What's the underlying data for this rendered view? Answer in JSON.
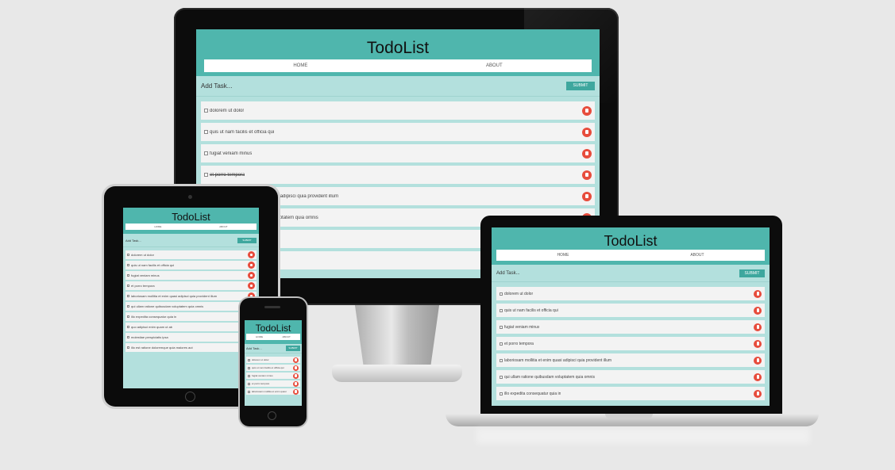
{
  "app": {
    "title": "TodoList",
    "nav": [
      "Home",
      "About"
    ],
    "add_placeholder": "Add Task...",
    "submit_label": "Submit"
  },
  "colors": {
    "header": "#4fb6ad",
    "body": "#b3e0dd",
    "task_bg": "#f3f3f3",
    "delete": "#e74c3c",
    "button": "#3ea79e",
    "background": "#e8e8e8"
  },
  "desktop": {
    "tasks": [
      {
        "text": "dolorem ut dolor",
        "done": false
      },
      {
        "text": "quis ut nam facilis et officia qui",
        "done": false
      },
      {
        "text": "fugiat veniam minus",
        "done": false
      },
      {
        "text": "et porro tempora",
        "done": true
      },
      {
        "text": "laboriosam mollitia et enim quasi adipisci quia provident illum",
        "done": false
      },
      {
        "text": "qui ullam ratione quibusdam voluptatem quia omnis",
        "done": false
      },
      {
        "text": "",
        "done": false
      },
      {
        "text": "",
        "done": false
      }
    ]
  },
  "laptop": {
    "tasks": [
      {
        "text": "dolorem ut dolor",
        "done": false
      },
      {
        "text": "quis ut nam facilis et officia qui",
        "done": false
      },
      {
        "text": "fugiat veniam minus",
        "done": false
      },
      {
        "text": "et porro tempora",
        "done": false
      },
      {
        "text": "laboriosam mollitia et enim quasi adipisci quia provident illum",
        "done": false
      },
      {
        "text": "qui ullam ratione quibusdam voluptatem quia omnis",
        "done": false
      },
      {
        "text": "illo expedita consequatur quia in",
        "done": false
      }
    ]
  },
  "tablet": {
    "tasks": [
      {
        "text": "dolorem ut dolor",
        "done": false
      },
      {
        "text": "quis ut nam facilis et officia qui",
        "done": false
      },
      {
        "text": "fugiat veniam minus",
        "done": false
      },
      {
        "text": "et porro tempora",
        "done": false
      },
      {
        "text": "laboriosam mollitia et enim quasi adipisci quia provident illum",
        "done": false
      },
      {
        "text": "qui ullam ratione quibusdam voluptatem quia omnis",
        "done": false
      },
      {
        "text": "illo expedita consequatur quia in",
        "done": false
      },
      {
        "text": "quo adipisci enim quam ut ab",
        "done": false
      },
      {
        "text": "molestiae perspiciatis ipsa",
        "done": false
      },
      {
        "text": "illo est ratione doloremque quia maiores aut",
        "done": false
      }
    ]
  },
  "phone": {
    "tasks": [
      {
        "text": "dolorem ut dolor",
        "done": false
      },
      {
        "text": "quis ut nam facilis et officia qui",
        "done": false
      },
      {
        "text": "fugiat veniam minus",
        "done": false
      },
      {
        "text": "et porro tempora",
        "done": false
      },
      {
        "text": "laboriosam mollitia et enim quasi",
        "done": false
      }
    ]
  }
}
